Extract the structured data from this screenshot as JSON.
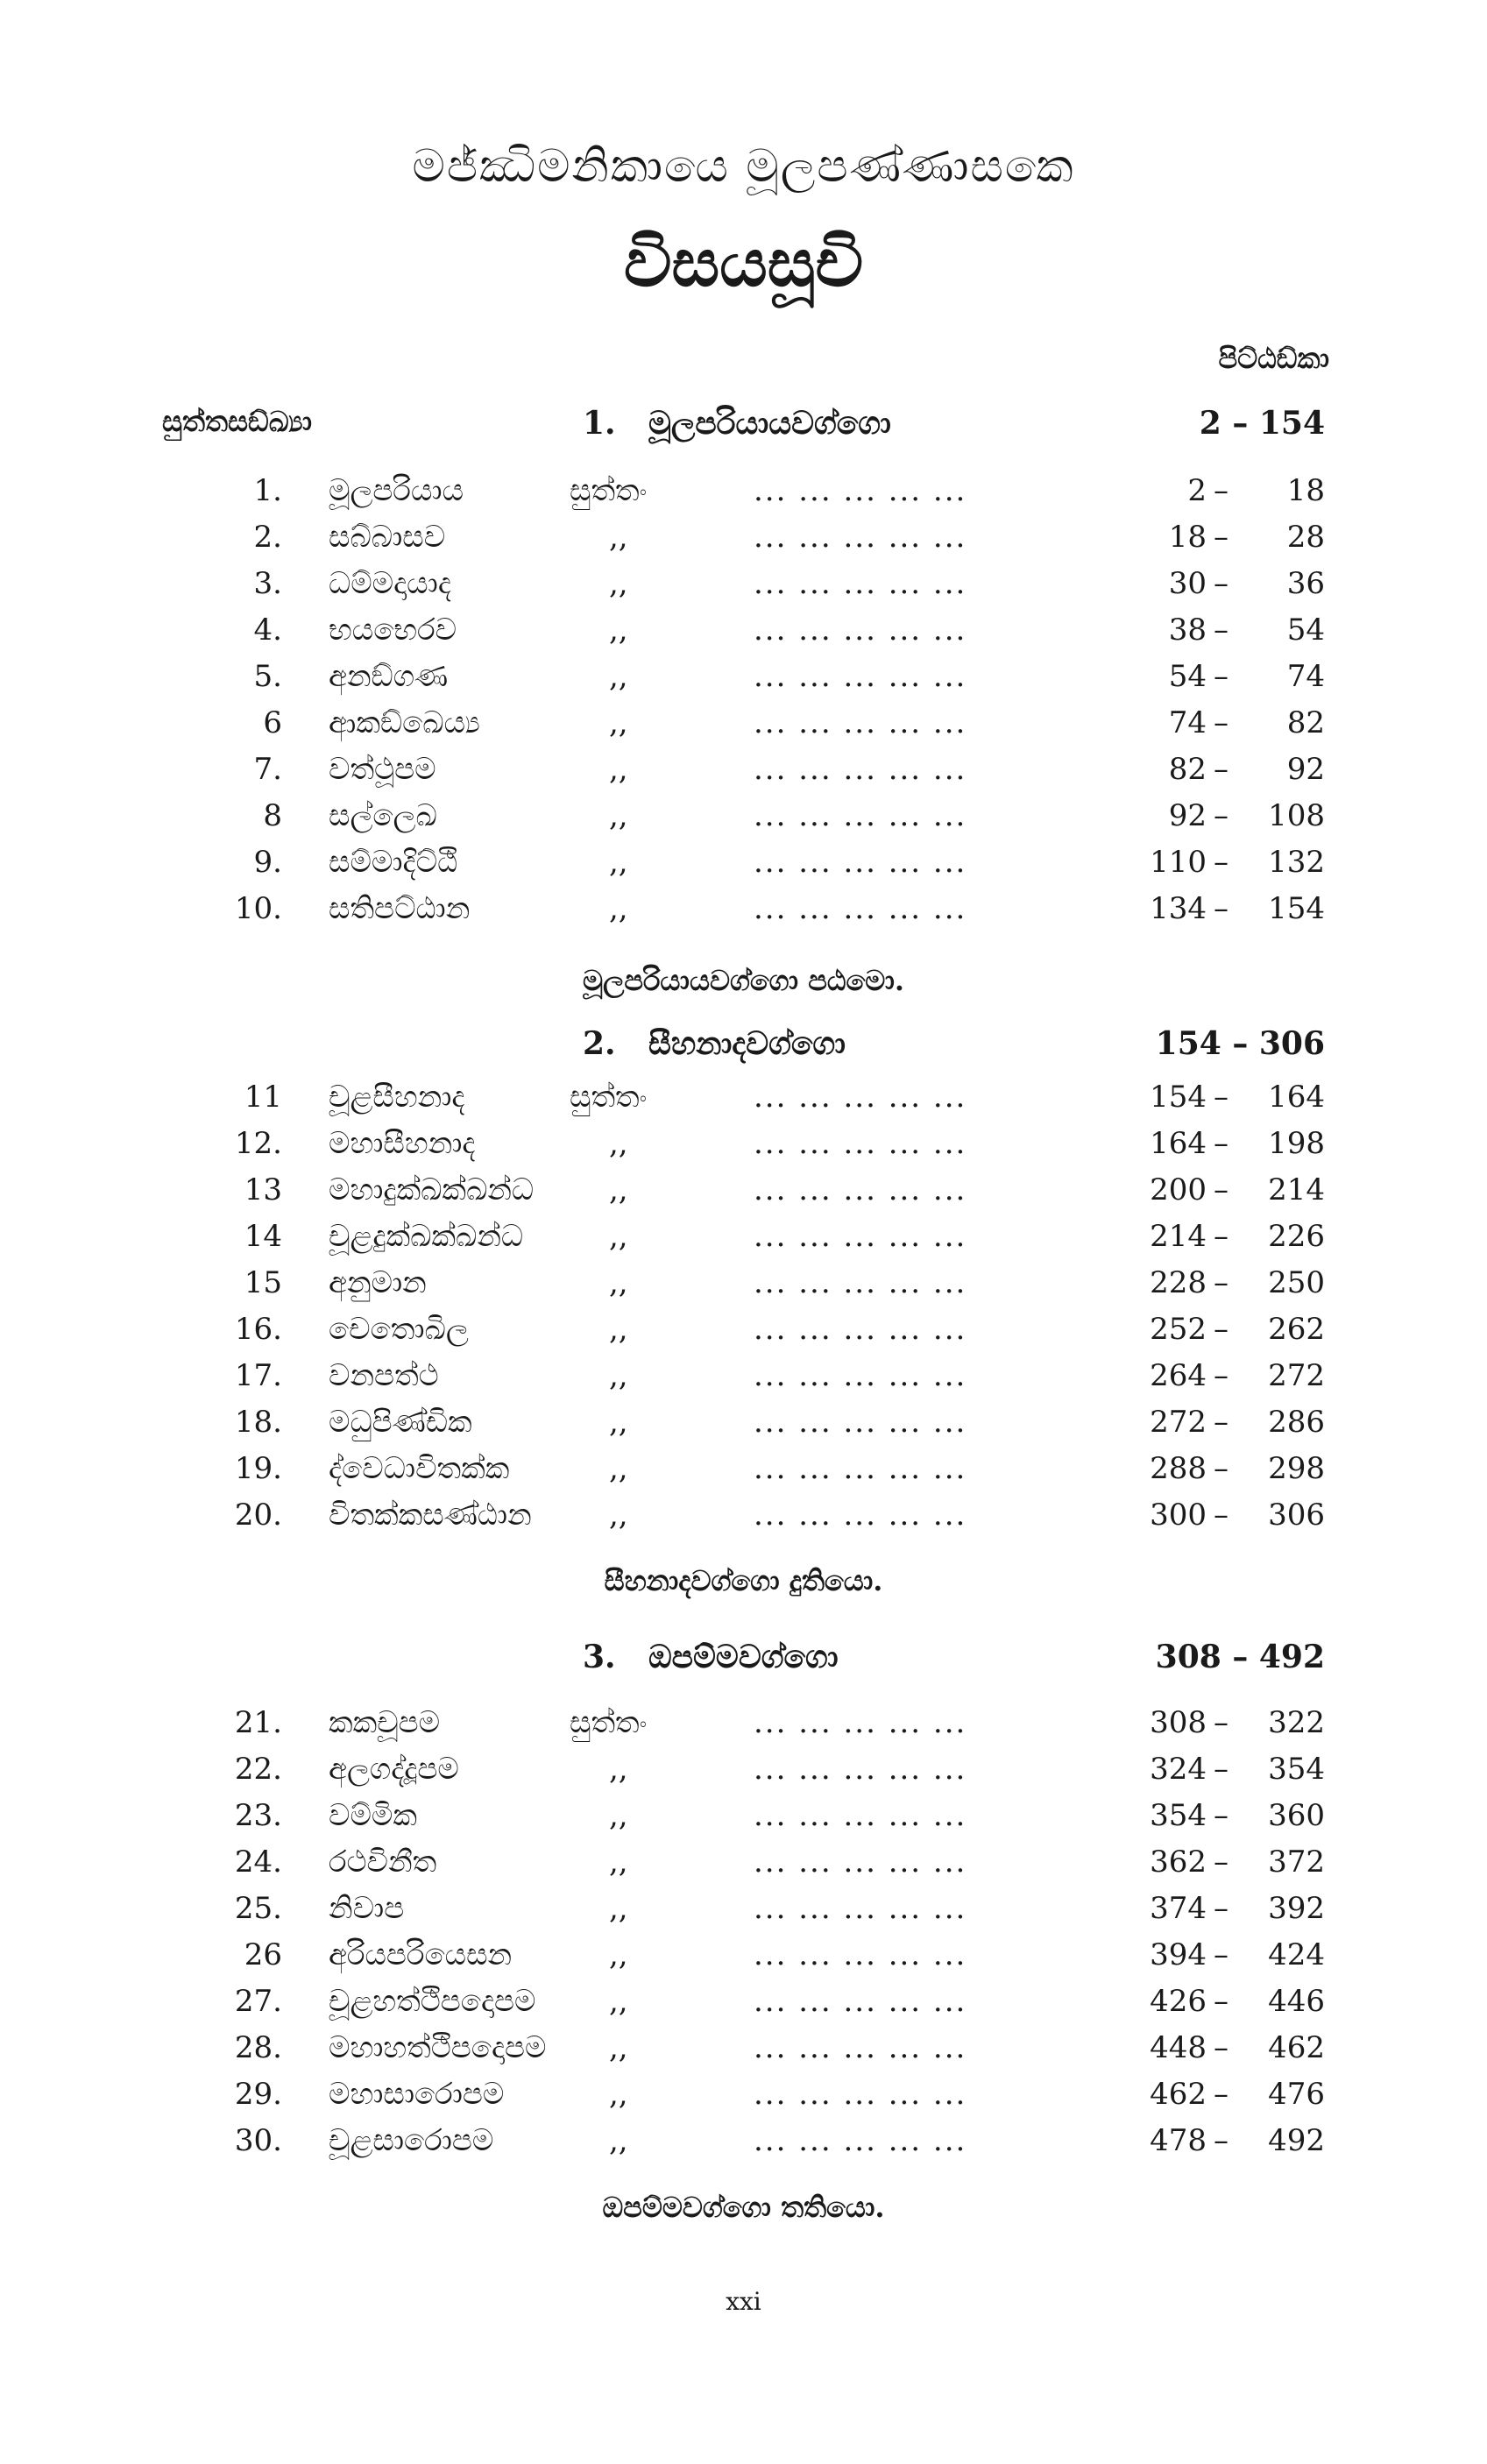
{
  "header": {
    "title": "මජ්ඣිමනිකායෙ මූලපණ්ණාසකෙ",
    "subtitle": "විසයසූචි",
    "page_column_label": "පිට්ඨඞ්කා",
    "number_column_label": "සුත්තසඞ්ඛ්‍යා"
  },
  "sections": [
    {
      "number": "1.",
      "title": "මූලපරියායවග්ගො",
      "pages": "2 – 154",
      "closing": "මූලපරියායවග්ගො පඨමො.",
      "rows": [
        {
          "no": "1.",
          "name": "මූලපරියාය",
          "suffix": "සුත්තං",
          "dots": "... ... ... ... ...",
          "from": "2",
          "to": "18"
        },
        {
          "no": "2.",
          "name": "සබ්බාසව",
          "suffix": ",,",
          "dots": "... ... ... ... ...",
          "from": "18",
          "to": "28"
        },
        {
          "no": "3.",
          "name": "ධම්මදායාද",
          "suffix": ",,",
          "dots": "... ... ... ... ...",
          "from": "30",
          "to": "36"
        },
        {
          "no": "4.",
          "name": "භයභෙරව",
          "suffix": ",,",
          "dots": "... ... ... ... ...",
          "from": "38",
          "to": "54"
        },
        {
          "no": "5.",
          "name": "අනඞ්ගණ",
          "suffix": ",,",
          "dots": "... ... ... ... ...",
          "from": "54",
          "to": "74"
        },
        {
          "no": "6",
          "name": "ආකඞ්ඛෙය්‍ය",
          "suffix": ",,",
          "dots": "... ... ... ... ...",
          "from": "74",
          "to": "82"
        },
        {
          "no": "7.",
          "name": "වත්ථූපම",
          "suffix": ",,",
          "dots": "... ... ... ... ...",
          "from": "82",
          "to": "92"
        },
        {
          "no": "8",
          "name": "සල්ලෙඛ",
          "suffix": ",,",
          "dots": "... ... ... ... ...",
          "from": "92",
          "to": "108"
        },
        {
          "no": "9.",
          "name": "සම්මාදිට්ඨි",
          "suffix": ",,",
          "dots": "... ... ... ... ...",
          "from": "110",
          "to": "132"
        },
        {
          "no": "10.",
          "name": "සතිපට්ඨාන",
          "suffix": ",,",
          "dots": "... ... ... ... ...",
          "from": "134",
          "to": "154"
        }
      ]
    },
    {
      "number": "2.",
      "title": "සීහනාදවග්ගො",
      "pages": "154 – 306",
      "closing": "සීහනාදවග්ගො දුතියො.",
      "rows": [
        {
          "no": "11",
          "name": "චූළසීහනාද",
          "suffix": "සුත්තං",
          "dots": "... ... ... ... ...",
          "from": "154",
          "to": "164"
        },
        {
          "no": "12.",
          "name": "මහාසීහනාද",
          "suffix": ",,",
          "dots": "... ... ... ... ...",
          "from": "164",
          "to": "198"
        },
        {
          "no": "13",
          "name": "මහාදුක්ඛක්ඛන්ධ",
          "suffix": ",,",
          "dots": "... ... ... ... ...",
          "from": "200",
          "to": "214"
        },
        {
          "no": "14",
          "name": "චූළදුක්ඛක්ඛන්ධ",
          "suffix": ",,",
          "dots": "... ... ... ... ...",
          "from": "214",
          "to": "226"
        },
        {
          "no": "15",
          "name": "අනුමාන",
          "suffix": ",,",
          "dots": "... ... ... ... ...",
          "from": "228",
          "to": "250"
        },
        {
          "no": "16.",
          "name": "චෙතොඛිල",
          "suffix": ",,",
          "dots": "... ... ... ... ...",
          "from": "252",
          "to": "262"
        },
        {
          "no": "17.",
          "name": "වනපත්ථ",
          "suffix": ",,",
          "dots": "... ... ... ... ...",
          "from": "264",
          "to": "272"
        },
        {
          "no": "18.",
          "name": "මධුපිණ්ඩික",
          "suffix": ",,",
          "dots": "... ... ... ... ...",
          "from": "272",
          "to": "286"
        },
        {
          "no": "19.",
          "name": "ද්වෙධාවිතක්ක",
          "suffix": ",,",
          "dots": "... ... ... ... ...",
          "from": "288",
          "to": "298"
        },
        {
          "no": "20.",
          "name": "විතක්කසණ්ඨාන",
          "suffix": ",,",
          "dots": "... ... ... ... ...",
          "from": "300",
          "to": "306"
        }
      ]
    },
    {
      "number": "3.",
      "title": "ඔපම්මවග්ගො",
      "pages": "308 – 492",
      "closing": "ඔපම්මවග්ගො තතියො.",
      "rows": [
        {
          "no": "21.",
          "name": "කකචූපම",
          "suffix": "සුත්තං",
          "dots": "... ... ... ... ...",
          "from": "308",
          "to": "322"
        },
        {
          "no": "22.",
          "name": "අලගද්දූපම",
          "suffix": ",,",
          "dots": "... ... ... ... ...",
          "from": "324",
          "to": "354"
        },
        {
          "no": "23.",
          "name": "වම්මික",
          "suffix": ",,",
          "dots": "... ... ... ... ...",
          "from": "354",
          "to": "360"
        },
        {
          "no": "24.",
          "name": "රථවිනීත",
          "suffix": ",,",
          "dots": "... ... ... ... ...",
          "from": "362",
          "to": "372"
        },
        {
          "no": "25.",
          "name": "නිවාප",
          "suffix": ",,",
          "dots": "... ... ... ... ...",
          "from": "374",
          "to": "392"
        },
        {
          "no": "26",
          "name": "අරියපරියෙසන",
          "suffix": ",,",
          "dots": "... ... ... ... ...",
          "from": "394",
          "to": "424"
        },
        {
          "no": "27.",
          "name": "චූළහත්ථිපදොපම",
          "suffix": ",,",
          "dots": "... ... ... ... ...",
          "from": "426",
          "to": "446"
        },
        {
          "no": "28.",
          "name": "මහාහත්ථිපදොපම",
          "suffix": ",,",
          "dots": "... ... ... ... ...",
          "from": "448",
          "to": "462"
        },
        {
          "no": "29.",
          "name": "මහාසාරොපම",
          "suffix": ",,",
          "dots": "... ... ... ... ...",
          "from": "462",
          "to": "476"
        },
        {
          "no": "30.",
          "name": "චූළසාරොපම",
          "suffix": ",,",
          "dots": "... ... ... ... ...",
          "from": "478",
          "to": "492"
        }
      ]
    }
  ],
  "footer": {
    "folio": "xxi"
  }
}
